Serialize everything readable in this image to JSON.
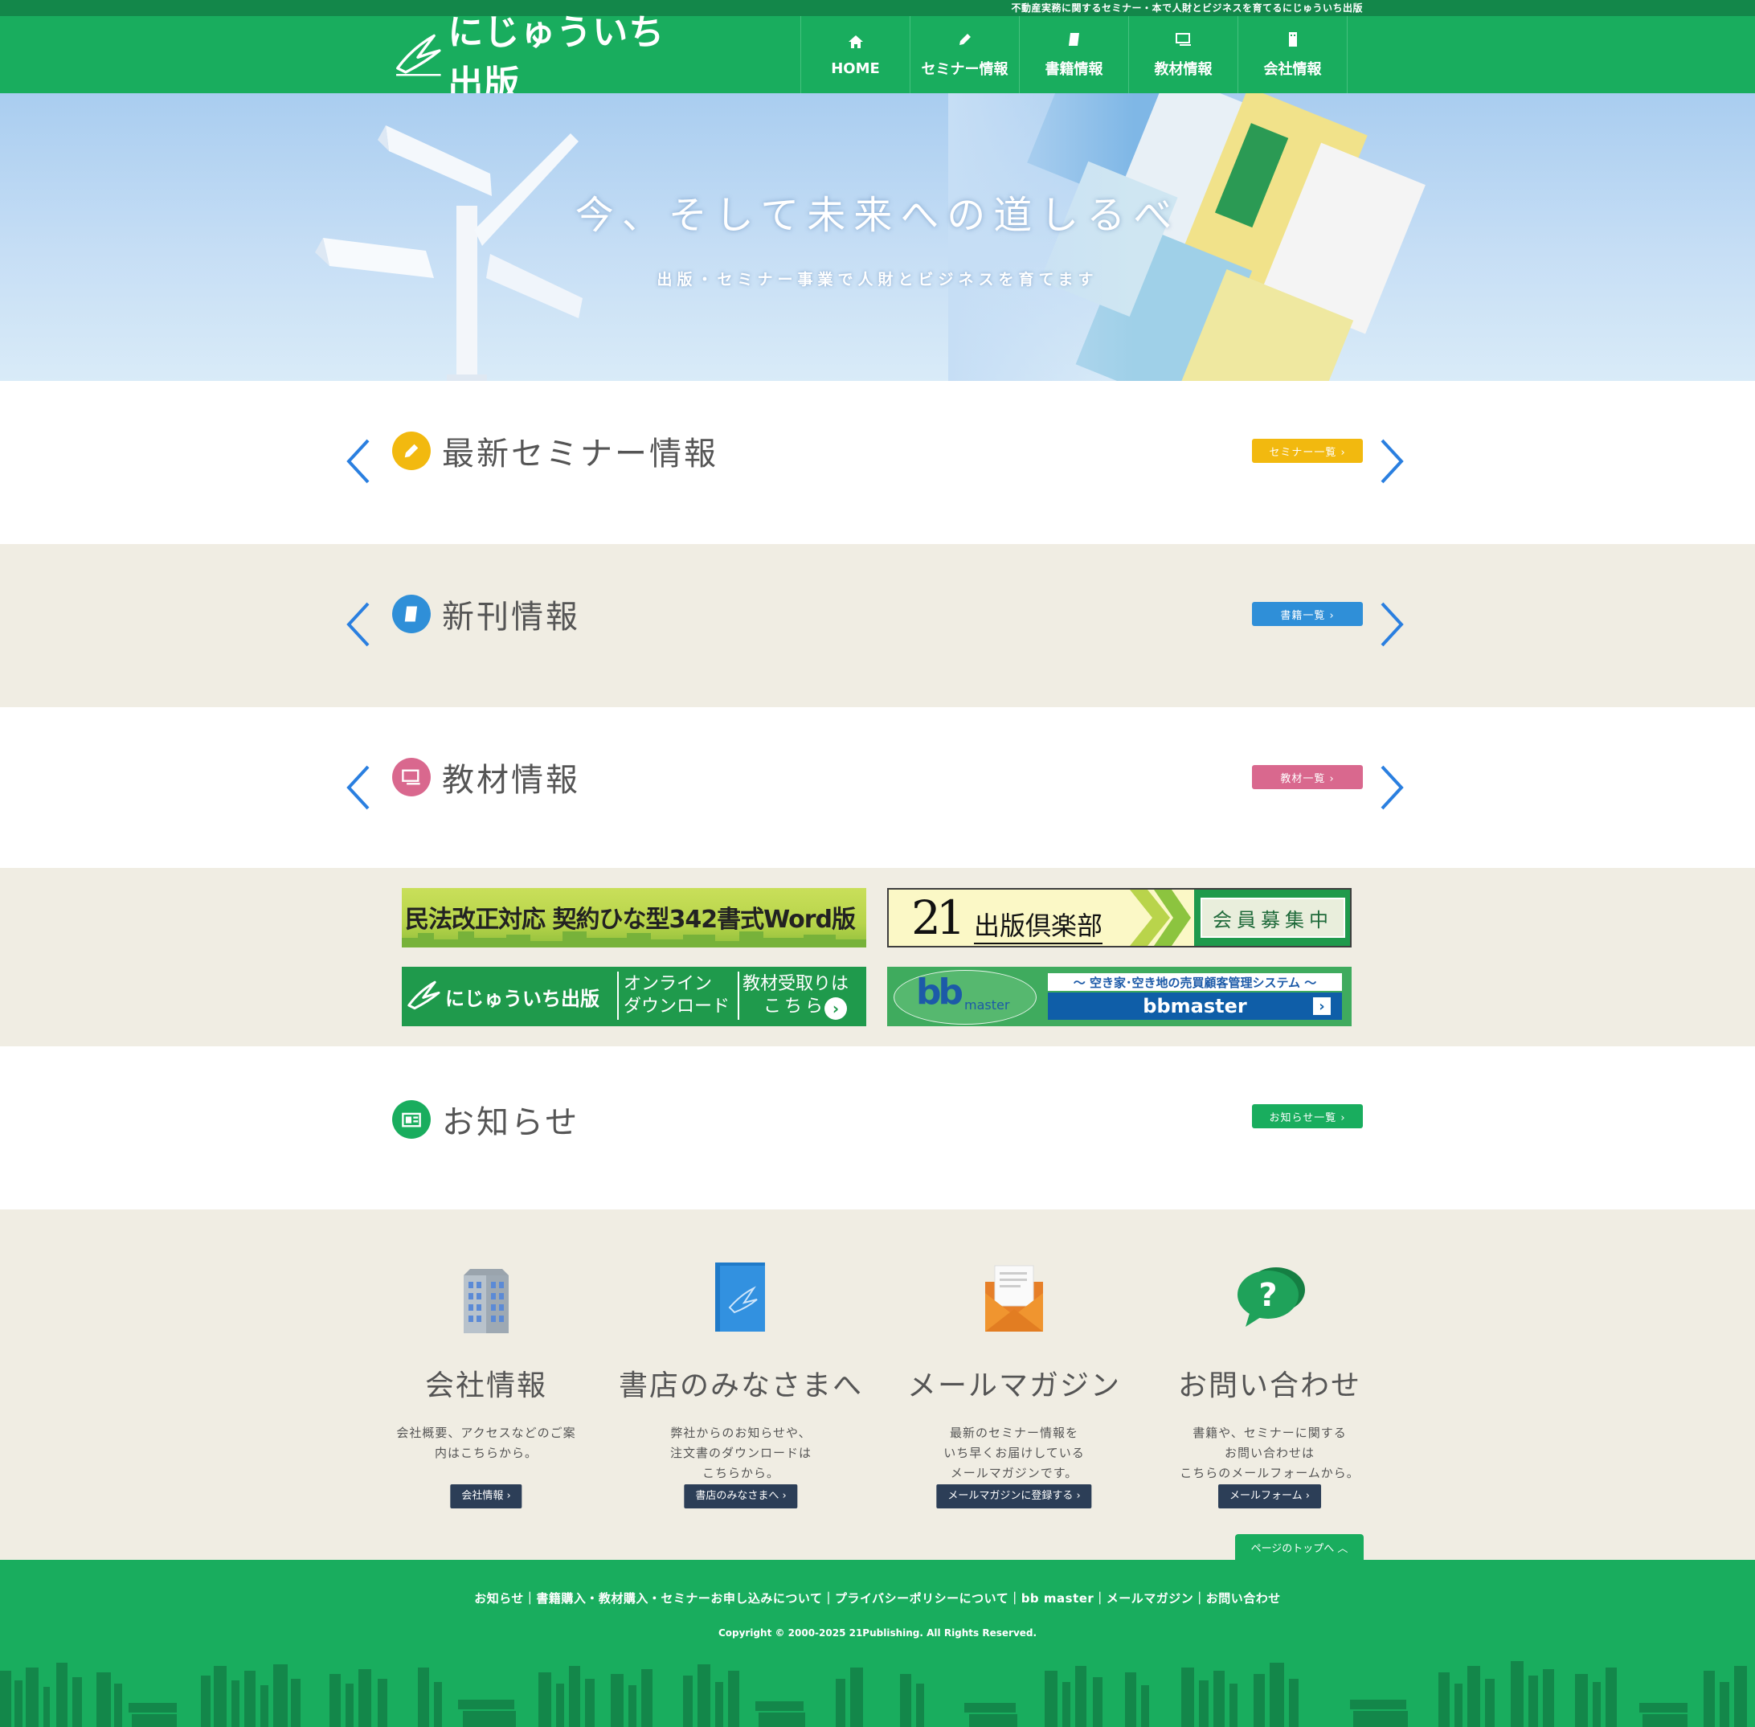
{
  "header": {
    "tagline": "不動産実務に関するセミナー・本で人財とビジネスを育てるにじゅういち出版",
    "logo_text": "にじゅういち出版",
    "nav": [
      {
        "label": "HOME",
        "icon": "home-icon"
      },
      {
        "label": "セミナー情報",
        "icon": "pencil-icon"
      },
      {
        "label": "書籍情報",
        "icon": "book-icon"
      },
      {
        "label": "教材情報",
        "icon": "monitor-icon"
      },
      {
        "label": "会社情報",
        "icon": "building-icon"
      }
    ]
  },
  "hero": {
    "title": "今、そして未来への道しるべ",
    "subtitle": "出版・セミナー事業で人財とビジネスを育てます"
  },
  "sections": {
    "seminar": {
      "title": "最新セミナー情報",
      "button": "セミナー一覧 ›",
      "color": "#f2b90f"
    },
    "books": {
      "title": "新刊情報",
      "button": "書籍一覧 ›",
      "color": "#2f8fd8"
    },
    "materials": {
      "title": "教材情報",
      "button": "教材一覧 ›",
      "color": "#d9688e"
    },
    "news": {
      "title": "お知らせ",
      "button": "お知らせ一覧 ›",
      "color": "#19ad5e"
    }
  },
  "banners": {
    "civil_law": "民法改正対応 契約ひな型342書式Word版",
    "club_num": "21",
    "club_text": "出版倶楽部",
    "club_badge": "会員募集中",
    "download_logo": "にじゅういち出版",
    "download_line1": "オンライン",
    "download_line2": "ダウンロード",
    "download_receive1": "教材受取りは",
    "download_receive2": "こちら",
    "bb_logo_main": "bb",
    "bb_logo_sub": "master",
    "bb_caption": "～ 空き家･空き地の売買顧客管理システム ～",
    "bb_name": "bbmaster"
  },
  "footer_columns": [
    {
      "title": "会社情報",
      "desc": "会社概要、アクセスなどのご案\n内はこちらから。",
      "button": "会社情報 ›"
    },
    {
      "title": "書店のみなさまへ",
      "desc": "弊社からのお知らせや、\n注文書のダウンロードは\nこちらから。",
      "button": "書店のみなさまへ ›"
    },
    {
      "title": "メールマガジン",
      "desc": "最新のセミナー情報を\nいち早くお届けしている\nメールマガジンです。",
      "button": "メールマガジンに登録する ›"
    },
    {
      "title": "お問い合わせ",
      "desc": "書籍や、セミナーに関する\nお問い合わせは\nこちらのメールフォームから。",
      "button": "メールフォーム ›"
    }
  ],
  "page_top": "ページのトップへ ︿",
  "footer": {
    "links": "お知らせ｜書籍購入・教材購入・セミナーお申し込みについて｜プライバシーポリシーについて｜bb master｜メールマガジン｜お問い合わせ",
    "copyright": "Copyright © 2000-2025 21Publishing. All Rights Reserved."
  },
  "colors": {
    "brand_green": "#19ad5e",
    "dark_green": "#13874a",
    "beige": "#f0ede3",
    "navy_button": "#2c3e57",
    "arrow_blue": "#2a7fe0"
  }
}
